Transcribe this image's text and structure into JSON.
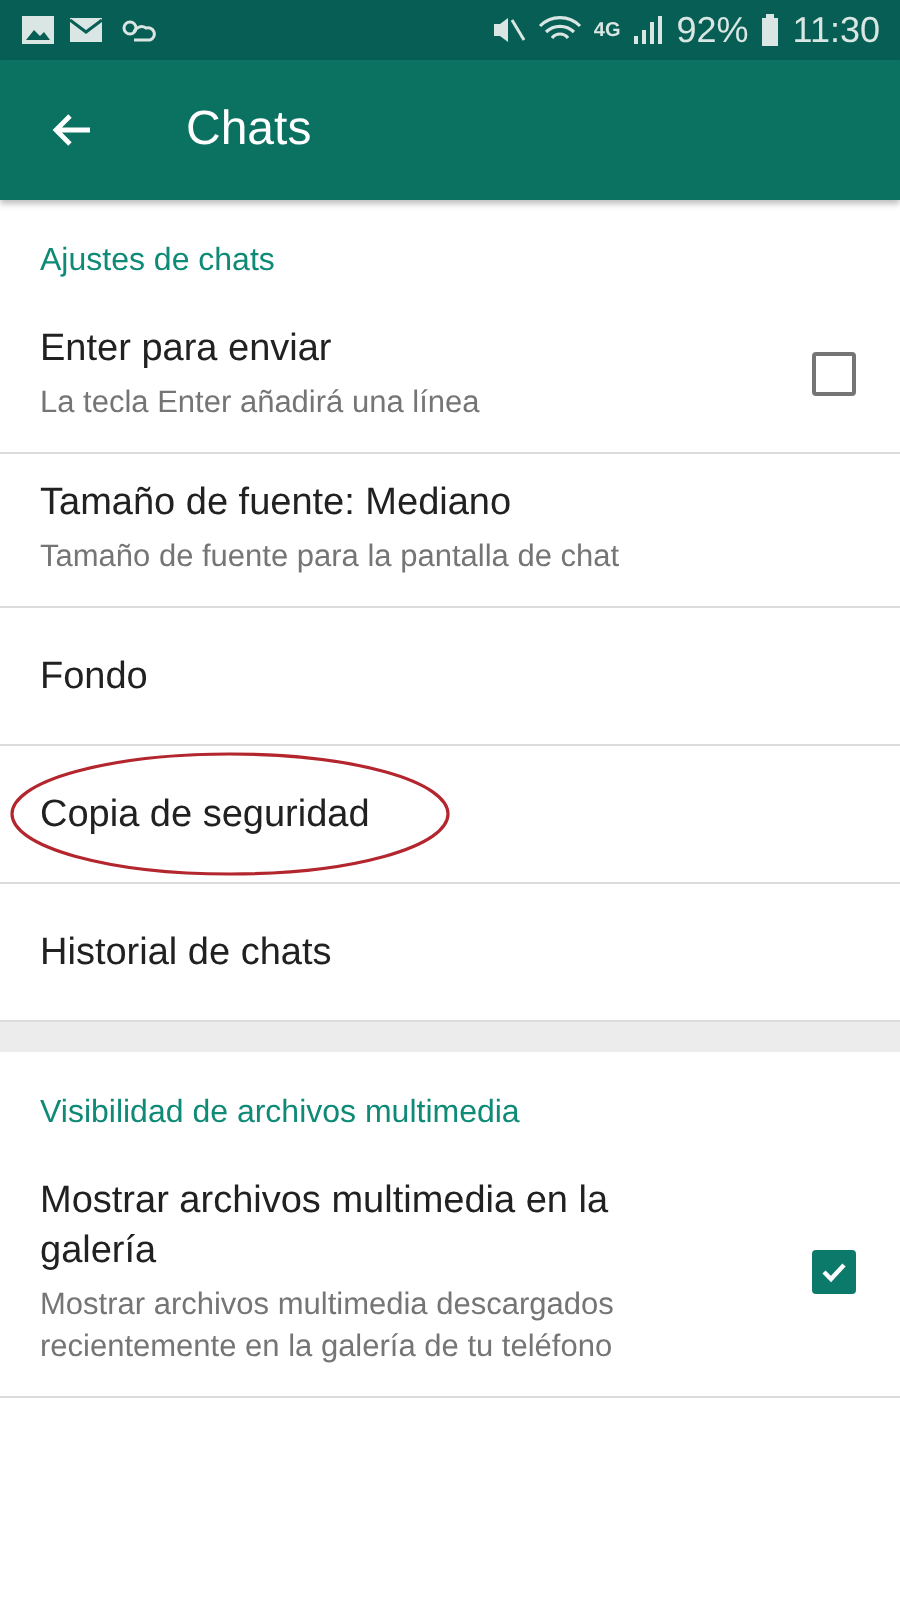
{
  "status_bar": {
    "network": "4G",
    "battery": "92%",
    "time": "11:30"
  },
  "app_bar": {
    "title": "Chats"
  },
  "sections": [
    {
      "header": "Ajustes de chats",
      "items": [
        {
          "kind": "checkbox",
          "title": "Enter para enviar",
          "subtitle": "La tecla Enter añadirá una línea",
          "checked": false,
          "highlighted": false
        },
        {
          "kind": "plain",
          "title": "Tamaño de fuente: Mediano",
          "subtitle": "Tamaño de fuente para la pantalla de chat",
          "highlighted": false
        },
        {
          "kind": "plain",
          "title": "Fondo",
          "highlighted": false
        },
        {
          "kind": "plain",
          "title": "Copia de seguridad",
          "highlighted": true
        },
        {
          "kind": "plain",
          "title": "Historial de chats",
          "highlighted": false
        }
      ]
    },
    {
      "header": "Visibilidad de archivos multimedia",
      "items": [
        {
          "kind": "checkbox",
          "title": "Mostrar archivos multimedia en la galería",
          "subtitle": "Mostrar archivos multimedia descargados recientemente en la galería de tu teléfono",
          "checked": true,
          "highlighted": false
        }
      ]
    }
  ]
}
